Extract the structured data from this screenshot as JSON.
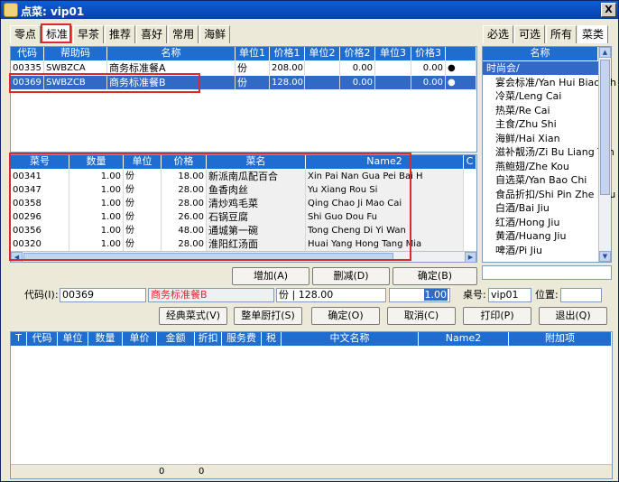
{
  "window": {
    "title": "点菜: vip01",
    "close_label": "X"
  },
  "left_tabs": [
    "零点",
    "标准",
    "早茶",
    "推荐",
    "喜好",
    "常用",
    "海鲜"
  ],
  "right_tabs": [
    "必选",
    "可选",
    "所有",
    "菜类"
  ],
  "std_table": {
    "headers": [
      "代码",
      "帮助码",
      "名称",
      "单位1",
      "价格1",
      "单位2",
      "价格2",
      "单位3",
      "价格3",
      ""
    ],
    "rows": [
      {
        "code": "00335",
        "help": "SWBZCA",
        "name": "商务标准餐A",
        "unit1": "份",
        "price1": "208.00",
        "unit2": "",
        "price2": "0.00",
        "unit3": "",
        "price3": "0.00",
        "mark": "●"
      },
      {
        "code": "00369",
        "help": "SWBZCB",
        "name": "商务标准餐B",
        "unit1": "份",
        "price1": "128.00",
        "unit2": "",
        "price2": "0.00",
        "unit3": "",
        "price3": "0.00",
        "mark": "●"
      }
    ]
  },
  "detail_table": {
    "headers": [
      "菜号",
      "数量",
      "单位",
      "价格",
      "菜名",
      "Name2",
      "C"
    ],
    "rows": [
      {
        "no": "00341",
        "qty": "1.00",
        "unit": "份",
        "price": "18.00",
        "name": "新派南瓜配百合",
        "name2": "Xin Pai Nan Gua Pei Bai H"
      },
      {
        "no": "00347",
        "qty": "1.00",
        "unit": "份",
        "price": "28.00",
        "name": "鱼香肉丝",
        "name2": "Yu Xiang Rou Si"
      },
      {
        "no": "00358",
        "qty": "1.00",
        "unit": "份",
        "price": "28.00",
        "name": "清炒鸡毛菜",
        "name2": "Qing Chao Ji Mao Cai"
      },
      {
        "no": "00296",
        "qty": "1.00",
        "unit": "份",
        "price": "26.00",
        "name": "石锅豆腐",
        "name2": "Shi Guo Dou Fu"
      },
      {
        "no": "00356",
        "qty": "1.00",
        "unit": "份",
        "price": "48.00",
        "name": "通城第一碗",
        "name2": "Tong Cheng Di Yi Wan"
      },
      {
        "no": "00320",
        "qty": "1.00",
        "unit": "份",
        "price": "28.00",
        "name": "淮阳红汤面",
        "name2": "Huai Yang Hong Tang Mia"
      }
    ]
  },
  "category_list": {
    "header": "名称",
    "items": [
      "时尚会/",
      "宴会标准/Yan Hui Biao Zh",
      "冷菜/Leng Cai",
      "热菜/Re Cai",
      "主食/Zhu Shi",
      "海鲜/Hai Xian",
      "滋补靓汤/Zi Bu Liang Tan",
      "燕鲍翅/Zhe Kou",
      "自选菜/Yan Bao Chi",
      "食品折扣/Shi Pin Zhe Kou",
      "白酒/Bai Jiu",
      "红酒/Hong Jiu",
      "黄酒/Huang Jiu",
      "啤酒/Pi Jiu"
    ]
  },
  "mid_buttons": {
    "add": "增加(A)",
    "delete": "删减(D)",
    "ok": "确定(B)"
  },
  "form": {
    "code_label": "代码(I):",
    "code_value": "00369",
    "name_value": "商务标准餐B",
    "unit_price_value": "份 | 128.00",
    "qty_value": "1.00",
    "table_label": "桌号:",
    "table_value": "vip01",
    "position_label": "位置:",
    "position_value": ""
  },
  "action_buttons": {
    "classic": "经典菜式(V)",
    "print_kitchen": "整单厨打(S)",
    "confirm": "确定(O)",
    "cancel": "取消(C)",
    "print": "打印(P)",
    "exit": "退出(Q)"
  },
  "order_table": {
    "headers": [
      "T",
      "代码",
      "单位",
      "数量",
      "单价",
      "金额",
      "折扣",
      "服务费",
      "税",
      "中文名称",
      "Name2",
      "附加项"
    ],
    "totals": [
      "0",
      "0"
    ]
  },
  "colors": {
    "accent": "#316ac5",
    "header": "#1f6dd0",
    "highlight_border": "#e0282a"
  }
}
